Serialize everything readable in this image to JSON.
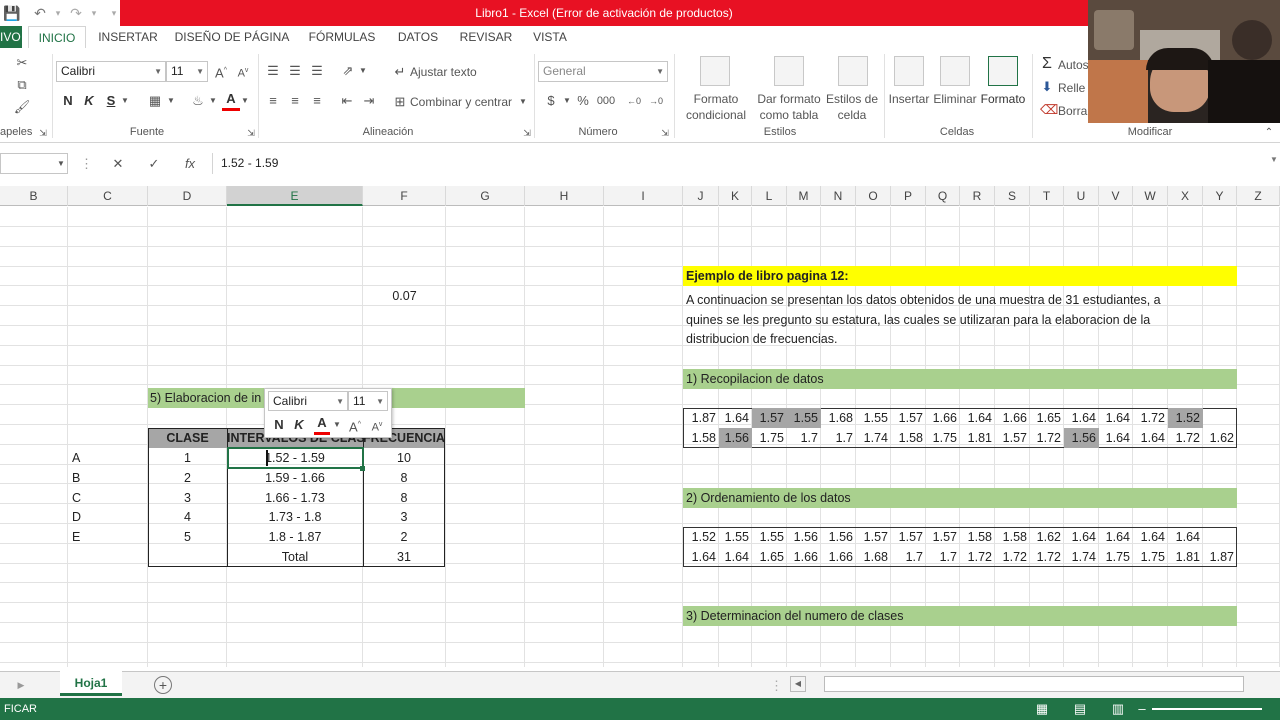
{
  "app": {
    "title": "Libro1 -  Excel (Error de activación de productos)"
  },
  "ribbon_tabs": [
    "IVO",
    "INICIO",
    "INSERTAR",
    "DISEÑO DE PÁGINA",
    "FÓRMULAS",
    "DATOS",
    "REVISAR",
    "VISTA"
  ],
  "ribbon": {
    "clipboard_label": "apeles",
    "font_name": "Calibri",
    "font_size": "11",
    "font_label": "Fuente",
    "bold": "N",
    "italic": "K",
    "underline": "S",
    "wrap_text": "Ajustar texto",
    "merge_center": "Combinar y centrar",
    "alignment_label": "Alineación",
    "number_format": "General",
    "number_label": "Número",
    "currency": "$",
    "percent": "%",
    "thousands": "000",
    "cond_format_1": "Formato",
    "cond_format_2": "condicional",
    "table_format_1": "Dar formato",
    "table_format_2": "como tabla",
    "cell_styles_1": "Estilos de",
    "cell_styles_2": "celda",
    "styles_label": "Estilos",
    "insert": "Insertar",
    "delete": "Eliminar",
    "format": "Formato",
    "cells_label": "Celdas",
    "autosum": "Autos",
    "fill": "Relle",
    "clear": "Borra",
    "modify_label": "Modificar"
  },
  "formula_bar": {
    "name_box": "",
    "content": "1.52 - 1.59",
    "cancel": "✕",
    "enter": "✓",
    "fx": "fx"
  },
  "columns": [
    "B",
    "C",
    "D",
    "E",
    "F",
    "G",
    "H",
    "I",
    "J",
    "K",
    "L",
    "M",
    "N",
    "O",
    "P",
    "Q",
    "R",
    "S",
    "T",
    "U",
    "V",
    "W",
    "X",
    "Y",
    "Z"
  ],
  "cells": {
    "f_value": "0.07",
    "section5": "5) Elaboracion de in",
    "hdr_clase": "CLASE",
    "hdr_intervalos": "INTERVALOS DE CLASE",
    "hdr_frecuencia": "FRECUENCIA",
    "rows": [
      {
        "letter": "A",
        "clase": "1",
        "intervalo": "1.52 - 1.59",
        "frecuencia": "10"
      },
      {
        "letter": "B",
        "clase": "2",
        "intervalo": "1.59 - 1.66",
        "frecuencia": "8"
      },
      {
        "letter": "C",
        "clase": "3",
        "intervalo": "1.66 - 1.73",
        "frecuencia": "8"
      },
      {
        "letter": "D",
        "clase": "4",
        "intervalo": "1.73 - 1.8",
        "frecuencia": "3"
      },
      {
        "letter": "E",
        "clase": "5",
        "intervalo": "1.8 - 1.87",
        "frecuencia": "2"
      }
    ],
    "total_label": "Total",
    "total_value": "31",
    "example_title": "Ejemplo de libro pagina 12:",
    "desc_line1": "A continuacion se presentan los datos obtenidos de una muestra de 31 estudiantes, a",
    "desc_line2": "quines se les pregunto su estatura, las cuales se utilizaran para la elaboracion de la",
    "desc_line3": "distribucion de frecuencias.",
    "step1": "1) Recopilacion de datos",
    "raw_row1": [
      "1.87",
      "1.64",
      "1.57",
      "1.55",
      "1.68",
      "1.55",
      "1.57",
      "1.66",
      "1.64",
      "1.66",
      "1.65",
      "1.64",
      "1.64",
      "1.72",
      "1.52",
      ""
    ],
    "raw_row2": [
      "1.58",
      "1.56",
      "1.75",
      "1.7",
      "1.7",
      "1.74",
      "1.58",
      "1.75",
      "1.81",
      "1.57",
      "1.72",
      "1.56",
      "1.64",
      "1.64",
      "1.72",
      "1.62"
    ],
    "step2": "2) Ordenamiento de los datos",
    "sorted_row1": [
      "1.52",
      "1.55",
      "1.55",
      "1.56",
      "1.56",
      "1.57",
      "1.57",
      "1.57",
      "1.58",
      "1.58",
      "1.62",
      "1.64",
      "1.64",
      "1.64",
      "1.64",
      ""
    ],
    "sorted_row2": [
      "1.64",
      "1.64",
      "1.65",
      "1.66",
      "1.66",
      "1.68",
      "1.7",
      "1.7",
      "1.72",
      "1.72",
      "1.72",
      "1.74",
      "1.75",
      "1.75",
      "1.81",
      "1.87"
    ],
    "step3": "3) Determinacion del numero de clases"
  },
  "mini_toolbar": {
    "font": "Calibri",
    "size": "11",
    "bold": "N",
    "italic": "K"
  },
  "sheet_tabs": [
    "Hoja1"
  ],
  "status": {
    "mode": "FICAR"
  },
  "colors": {
    "excel_green": "#217346",
    "title_red": "#e81123",
    "section_green": "#a9d08e",
    "header_gray": "#a6a6a6",
    "highlight_yellow": "#ffff00"
  }
}
